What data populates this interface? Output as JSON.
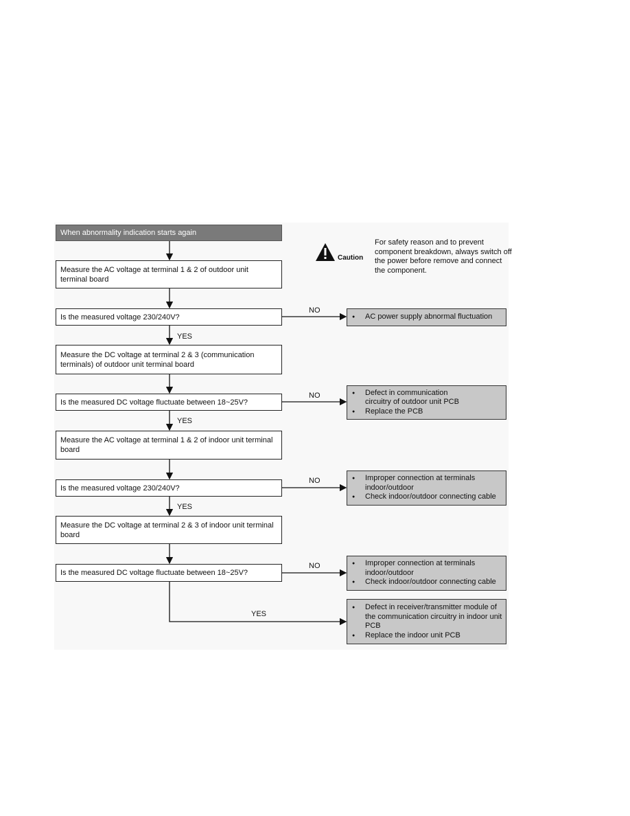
{
  "start": "When abnormality indication starts again",
  "caution": {
    "label": "Caution",
    "icon": "warning-triangle-icon",
    "text": "For safety reason and to prevent component breakdown, always switch off the power before remove and connect the component."
  },
  "steps": [
    "Measure the AC voltage at terminal 1 & 2 of outdoor unit terminal board",
    "Measure the DC voltage at terminal 2 & 3 (communication terminals) of outdoor unit terminal board",
    "Measure the AC voltage at terminal 1 & 2 of indoor unit terminal board",
    "Measure the DC voltage at terminal 2 & 3 of indoor unit terminal board"
  ],
  "questions": [
    "Is the measured voltage 230/240V?",
    "Is the measured DC voltage fluctuate between 18~25V?",
    "Is the measured voltage 230/240V?",
    "Is the measured DC voltage fluctuate between 18~25V?"
  ],
  "labels": {
    "yes": "YES",
    "no": "NO"
  },
  "results": [
    [
      "AC power supply abnormal fluctuation"
    ],
    [
      "Defect in communication circuitry of outdoor unit PCB",
      "Replace the PCB"
    ],
    [
      "Improper connection at terminals indoor/outdoor",
      "Check indoor/outdoor connecting cable"
    ],
    [
      "Improper connection at terminals indoor/outdoor",
      "Check indoor/outdoor connecting cable"
    ],
    [
      "Defect in receiver/transmitter module of the communication circuitry in indoor unit PCB",
      "Replace the indoor unit PCB"
    ]
  ],
  "colors": {
    "header": "#7a7a7a",
    "result": "#c8c8c8"
  }
}
